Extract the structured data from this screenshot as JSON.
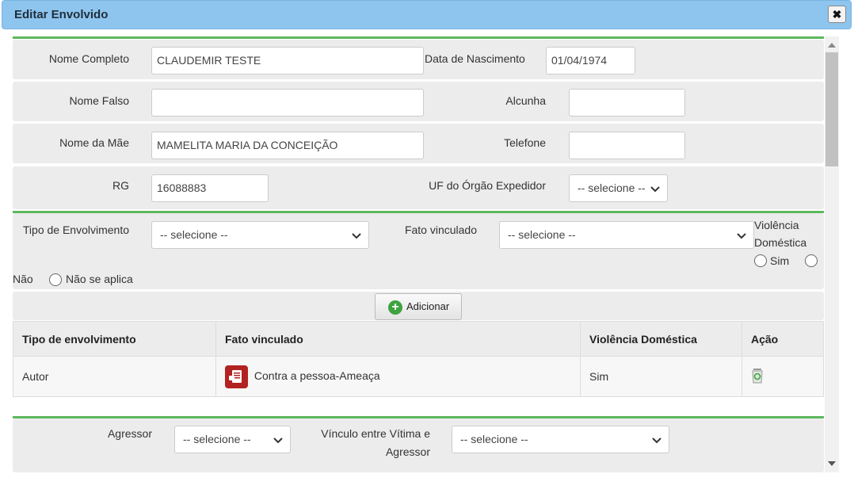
{
  "dialog": {
    "title": "Editar Envolvido",
    "close_label": "✖"
  },
  "pessoa": {
    "nome_completo_label": "Nome Completo",
    "nome_completo_value": "CLAUDEMIR TESTE",
    "data_nascimento_label": "Data de Nascimento",
    "data_nascimento_value": "01/04/1974",
    "nome_falso_label": "Nome Falso",
    "nome_falso_value": "",
    "alcunha_label": "Alcunha",
    "alcunha_value": "",
    "nome_mae_label": "Nome da Mãe",
    "nome_mae_value": "MAMELITA MARIA DA CONCEIÇÃO",
    "telefone_label": "Telefone",
    "telefone_value": "",
    "rg_label": "RG",
    "rg_value": "16088883",
    "uf_label": "UF do Órgão Expedidor",
    "uf_value": "-- selecione --"
  },
  "envolvimento": {
    "tipo_label": "Tipo de Envolvimento",
    "tipo_value": "-- selecione --",
    "fato_label": "Fato vinculado",
    "fato_value": "-- selecione --",
    "violencia_label_1": "Violência",
    "violencia_label_2": "Doméstica",
    "opt_sim": "Sim",
    "opt_nao": "Não",
    "opt_nao_aplica": "Não se aplica",
    "add_label": "Adicionar"
  },
  "table": {
    "headers": [
      "Tipo de envolvimento",
      "Fato vinculado",
      "Violência Doméstica",
      "Ação"
    ],
    "rows": [
      {
        "tipo": "Autor",
        "fato": "Contra a pessoa-Ameaça",
        "violencia": "Sim",
        "acao_icon": "recycle-bin-icon"
      }
    ]
  },
  "agressor": {
    "agressor_label": "Agressor",
    "agressor_value": "-- selecione --",
    "vinculo_label_1": "Vínculo entre Vítima e",
    "vinculo_label_2": "Agressor",
    "vinculo_value": "-- selecione --"
  },
  "colors": {
    "header_bg": "#8ec5ee",
    "accent_green": "#5cb85c",
    "row_bg": "#ececec",
    "case_icon": "#b32222"
  }
}
